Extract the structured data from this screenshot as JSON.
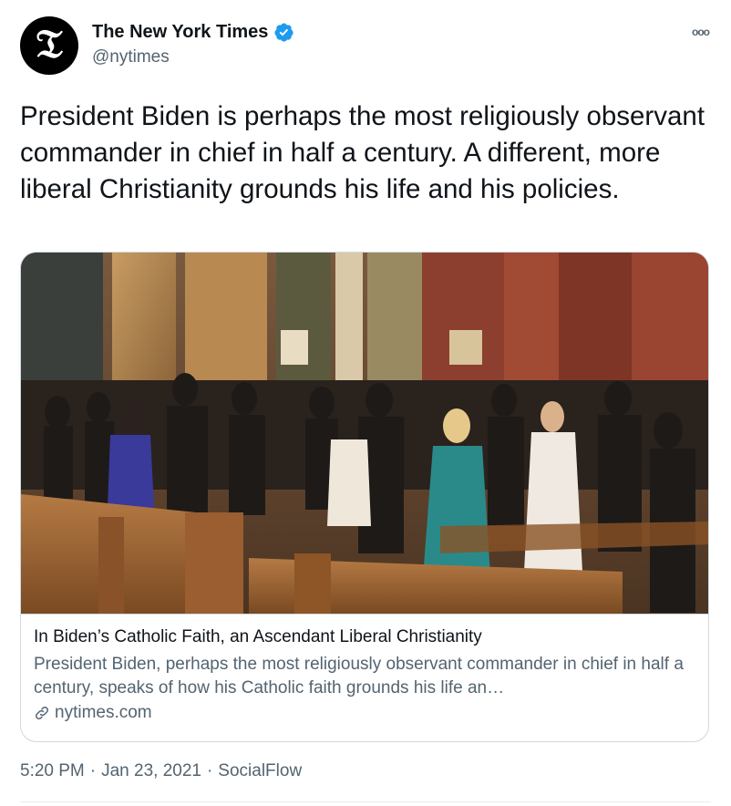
{
  "author": {
    "display_name": "The New York Times",
    "handle": "@nytimes",
    "avatar_glyph": "𝔗",
    "verified": true
  },
  "tweet": {
    "text": "President Biden is perhaps the most religiously observant commander in chief in half a century. A different, more liberal Christianity grounds his life and his policies."
  },
  "card": {
    "title": "In Biden’s Catholic Faith, an Ascendant Liberal Christianity",
    "description": "President Biden, perhaps the most religiously observant commander in chief in half a century, speaks of how his Catholic faith grounds his life an…",
    "domain": "nytimes.com",
    "image_subject": "Congregation standing in church pews during a service"
  },
  "meta": {
    "time": "5:20 PM",
    "separator_1": "·",
    "date": "Jan 23, 2021",
    "separator_2": "·",
    "source": "SocialFlow"
  },
  "colors": {
    "text_primary": "#0f1419",
    "text_secondary": "#536471",
    "verified_blue": "#1d9bf0",
    "border": "#cfd9de"
  },
  "icons": {
    "more": "more-dots-icon",
    "verified": "verified-badge-icon",
    "link": "link-icon"
  }
}
